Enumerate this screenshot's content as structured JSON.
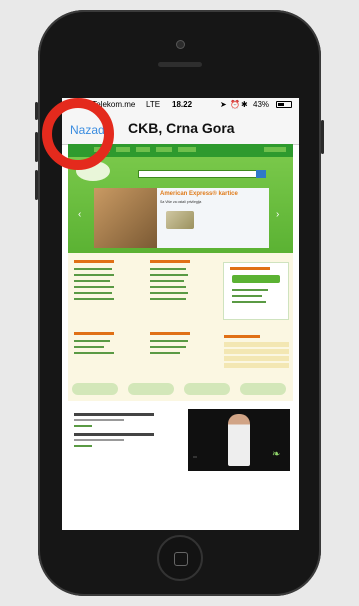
{
  "status_bar": {
    "carrier": "●●●●● Telekom.me",
    "network": "LTE",
    "time": "18.22",
    "battery": "43%"
  },
  "navbar": {
    "back_label": "Nazad",
    "title": "CKB, Crna Gora"
  },
  "site": {
    "banner": {
      "title": "American Express® kartice",
      "subtitle": "Sa Više za ostali privilegija"
    }
  },
  "annotations": {
    "ring_color": "#e42a1d"
  },
  "colors": {
    "nav_blue": "#3b8de0",
    "site_green": "#5bb233"
  }
}
